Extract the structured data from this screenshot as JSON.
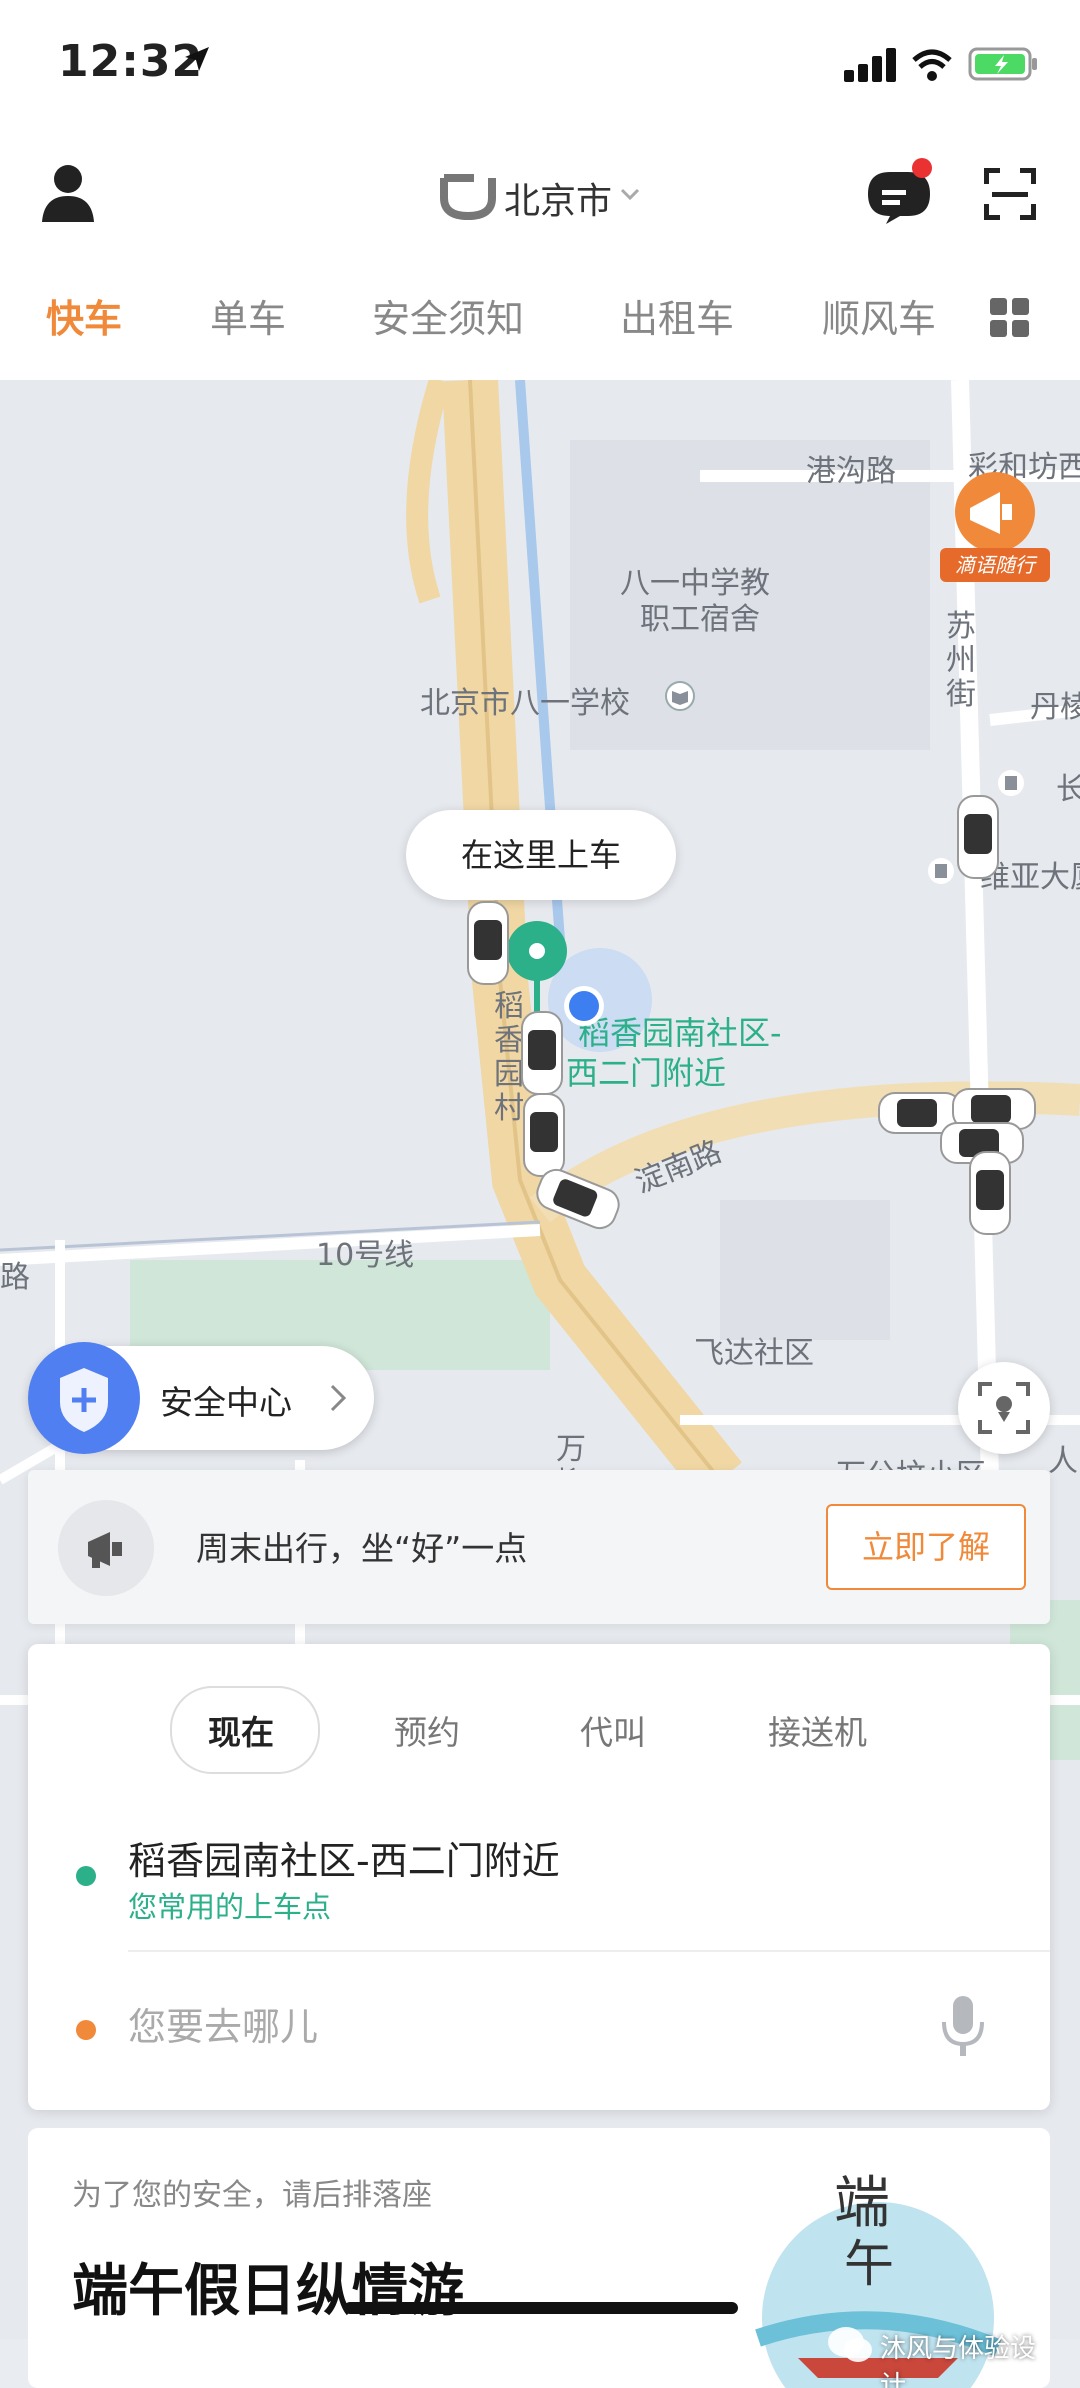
{
  "status_bar": {
    "time": "12:32"
  },
  "header": {
    "city": "北京市",
    "icons": [
      "profile-icon",
      "didi-logo-icon",
      "message-icon",
      "scan-icon"
    ],
    "tabs": [
      {
        "label": "快车",
        "active": true
      },
      {
        "label": "单车"
      },
      {
        "label": "安全须知"
      },
      {
        "label": "出租车"
      },
      {
        "label": "顺风车"
      }
    ]
  },
  "map": {
    "labels": {
      "ganggou_road": "港沟路",
      "caihefang": "彩和坊西",
      "bayi_teachers_dorm_1": "八一中学教",
      "bayi_teachers_dorm_2": "职工宿舍",
      "suzhou_st": "苏州街",
      "dan": "丹棱",
      "bayi_school": "北京市八一学校",
      "chang": "长",
      "weiya": "维亚大厦",
      "daoxiang_vertical": "稻香园村",
      "pickup_1": "稻香园南社区-",
      "pickup_2": "西二门附近",
      "dian_nan_road": "淀南路",
      "line10": "10号线",
      "lu": "路",
      "feida": "飞达社区",
      "wan_1": "万",
      "wan_2": "柳",
      "wangongzhuang": "万公坟小区",
      "ren": "人"
    },
    "pickup_bubble": "在这里上车",
    "ad_badge": "滴语随行"
  },
  "safety_center": {
    "label": "安全中心"
  },
  "promo": {
    "text": "周末出行，坐“好”一点",
    "button": "立即了解"
  },
  "ride_card": {
    "modes": [
      {
        "label": "现在",
        "selected": true
      },
      {
        "label": "预约"
      },
      {
        "label": "代叫"
      },
      {
        "label": "接送机"
      }
    ],
    "pickup": {
      "name": "稻香园南社区-西二门附近",
      "hint": "您常用的上车点"
    },
    "destination": {
      "placeholder": "您要去哪儿"
    }
  },
  "banner": {
    "subtitle": "为了您的安全，请后排落座",
    "title": "端午假日纵情游",
    "art_text_1": "端",
    "art_text_2": "午",
    "watermark": "沐风与体验设计"
  },
  "colors": {
    "accent": "#f08a3a",
    "green": "#2bb08a",
    "blue": "#3d7ef0"
  }
}
